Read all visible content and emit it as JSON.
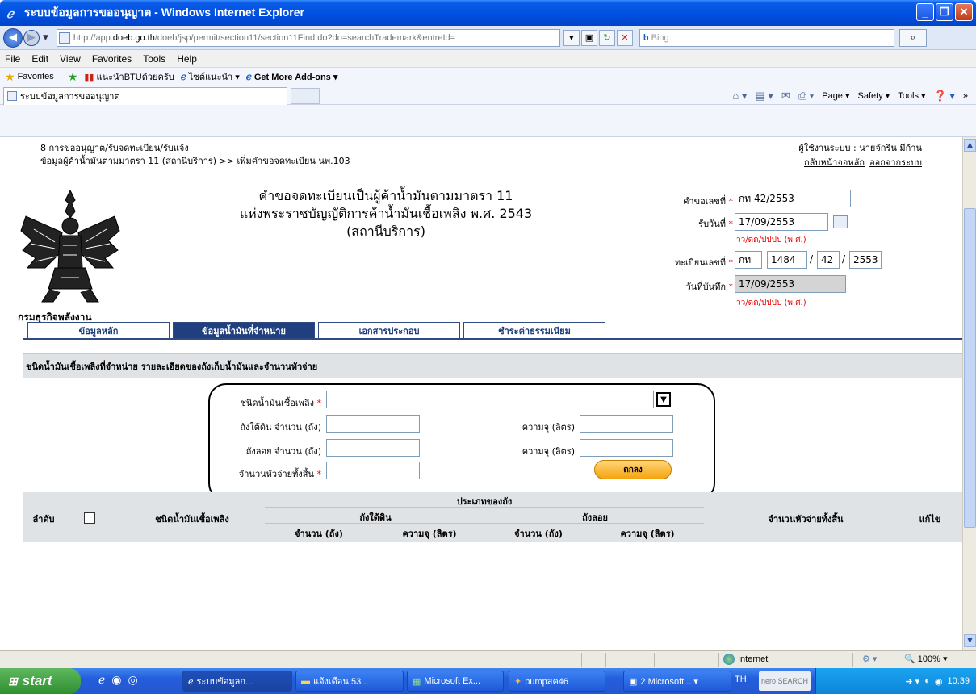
{
  "window": {
    "title": "ระบบข้อมูลการขออนุญาต - Windows Internet Explorer",
    "minimize": "_",
    "maximize": "❐",
    "close": "✕"
  },
  "browser": {
    "url_prefix": "http://app.",
    "url_domain": "doeb.go.th",
    "url_rest": "/doeb/jsp/permit/section11/section11Find.do?do=searchTrademark&entreId=",
    "search_placeholder": "Bing",
    "menu": [
      "File",
      "Edit",
      "View",
      "Favorites",
      "Tools",
      "Help"
    ],
    "favorites_label": "Favorites",
    "fav_items": [
      "แนะนำBTUด้วยครับ",
      "ไซต์แนะนำ ▾",
      "Get More Add-ons ▾"
    ],
    "tab_title": "ระบบข้อมูลการขออนุญาต",
    "commands": [
      "Page ▾",
      "Safety ▾",
      "Tools ▾"
    ]
  },
  "header": {
    "breadcrumb1": "8 การขออนุญาต/รับจดทะเบียน/รับแจ้ง",
    "breadcrumb2": "ข้อมูลผู้ค้าน้ำมันตามมาตรา 11 (สถานีบริการ) >> เพิ่มคำขอจดทะเบียน นพ.103",
    "user": "ผู้ใช้งานระบบ : นายจักริน มีก้าน",
    "link_home": "กลับหน้าจอหลัก",
    "link_logout": "ออกจากระบบ",
    "dept": "กรมธุรกิจพลังงาน"
  },
  "form": {
    "title1": "คำขอจดทะเบียนเป็นผู้ค้าน้ำมันตามมาตรา 11",
    "title2": "แห่งพระราชบัญญัติการค้าน้ำมันเชื้อเพลิง พ.ศ. 2543",
    "title3": "(สถานีบริการ)",
    "req_no_label": "คำขอเลขที่",
    "req_no": "กท 42/2553",
    "recv_date_label": "รับวันที่",
    "recv_date": "17/09/2553",
    "date_hint": "วว/ดด/ปปปป (พ.ศ.)",
    "reg_no_label": "ทะเบียนเลขที่",
    "reg_prov": "กท",
    "reg_num": "1484",
    "reg_seq": "42",
    "reg_year": "2553",
    "rec_date_label": "วันที่บันทึก",
    "rec_date": "17/09/2553",
    "slash": "/",
    "asterisk": "*"
  },
  "tabs": [
    "ข้อมูลหลัก",
    "ข้อมูลน้ำมันที่จำหน่าย",
    "เอกสารประกอบ",
    "ชำระค่าธรรมเนียม"
  ],
  "section": {
    "title": "ชนิดน้ำมันเชื้อเพลิงที่จำหน่าย รายละเอียดของถังเก็บน้ำมันและจำนวนหัวจ่าย",
    "fuel_type_label": "ชนิดน้ำมันเชื้อเพลิง",
    "underground_label": "ถังใต้ดิน จำนวน (ถัง)",
    "floating_label": "ถังลอย จำนวน (ถัง)",
    "capacity_label": "ความจุ (ลิตร)",
    "nozzles_label": "จำนวนหัวจ่ายทั้งสิ้น",
    "ok_button": "ตกลง"
  },
  "table": {
    "col_no": "ลำดับ",
    "col_fuel": "ชนิดน้ำมันเชื้อเพลิง",
    "col_tanktype": "ประเภทของถัง",
    "col_underground": "ถังใต้ดิน",
    "col_floating": "ถังลอย",
    "col_count": "จำนวน (ถัง)",
    "col_capacity": "ความจุ (ลิตร)",
    "col_nozzles": "จำนวนหัวจ่ายทั้งสิ้น",
    "col_edit": "แก้ไข"
  },
  "status": {
    "zone": "Internet",
    "zoom": "100%"
  },
  "taskbar": {
    "start": "start",
    "tasks": [
      "ระบบข้อมูลก...",
      "แจ้งเดือน 53...",
      "Microsoft Ex...",
      "pumpสค46",
      "2 Microsoft...  ▾"
    ],
    "lang": "TH",
    "nero": "nero SEARCH",
    "time": "10:39"
  }
}
